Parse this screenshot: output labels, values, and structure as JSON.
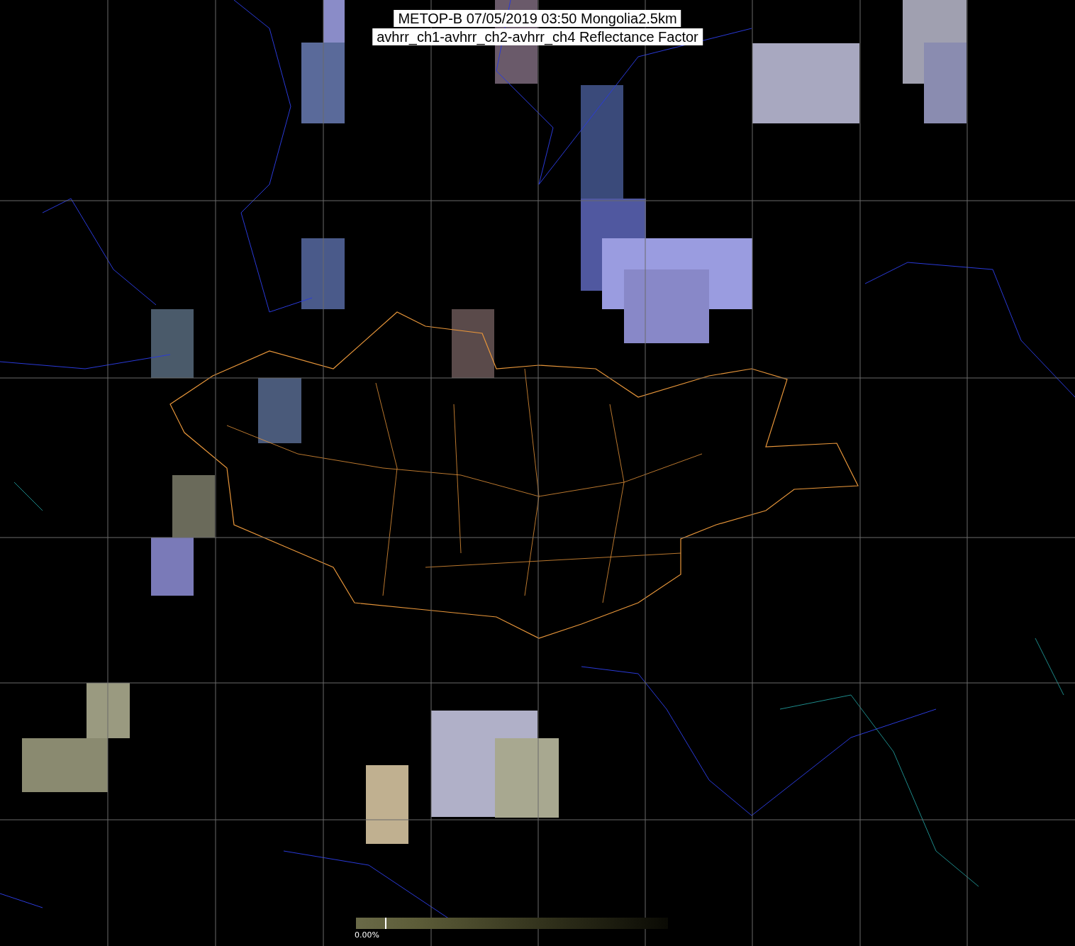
{
  "title": {
    "lines": [
      "METOP-B 07/05/2019 03:50 Mongolia2.5km",
      "avhrr_ch1-avhrr_ch2-avhrr_ch4 Reflectance Factor"
    ]
  },
  "colorbar": {
    "label": "0.00%"
  }
}
